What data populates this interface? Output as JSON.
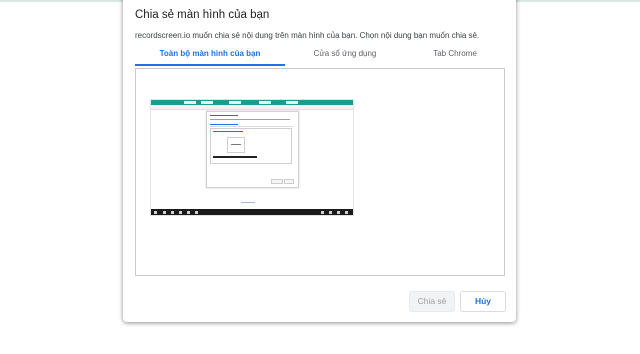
{
  "dialog": {
    "title": "Chia sẻ màn hình của bạn",
    "subtitle": "recordscreen.io muốn chia sẻ nội dung trên màn hình của bạn. Chọn nội dung bạn muốn chia sẻ.",
    "tabs": [
      {
        "label": "Toàn bộ màn hình của bạn",
        "selected": true
      },
      {
        "label": "Cửa sổ ứng dụng",
        "selected": false
      },
      {
        "label": "Tab Chrome",
        "selected": false
      }
    ],
    "buttons": {
      "share_label": "Chia sẻ",
      "share_enabled": false,
      "cancel_label": "Hủy"
    }
  },
  "colors": {
    "accent": "#1a73e8",
    "thumbnail_tabbar": "#1a9c8f",
    "taskbar": "#1b1b1b"
  }
}
